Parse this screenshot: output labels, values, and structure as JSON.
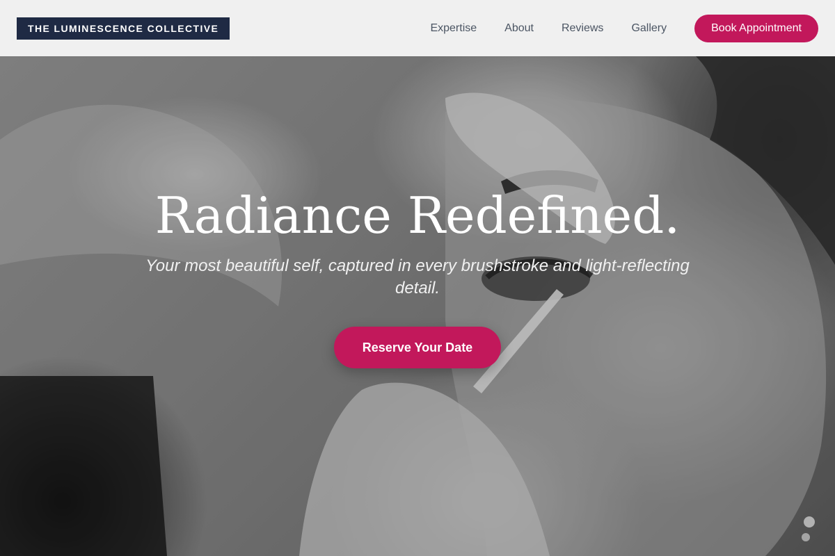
{
  "brand": {
    "name": "THE LUMINESCENCE COLLECTIVE"
  },
  "nav": {
    "items": [
      "Expertise",
      "About",
      "Reviews",
      "Gallery"
    ],
    "cta_label": "Book Appointment"
  },
  "hero": {
    "title": "Radiance Redefined.",
    "subtitle": "Your most beautiful self, captured in every brushstroke and light-reflecting detail.",
    "cta_label": "Reserve Your Date",
    "image_alt": "Black-and-white close-up of a makeup artist applying eye makeup"
  },
  "colors": {
    "brand_bg": "#1f2a44",
    "accent": "#c2185b",
    "nav_text": "#4b5563",
    "header_bg": "#f6f6f6"
  }
}
